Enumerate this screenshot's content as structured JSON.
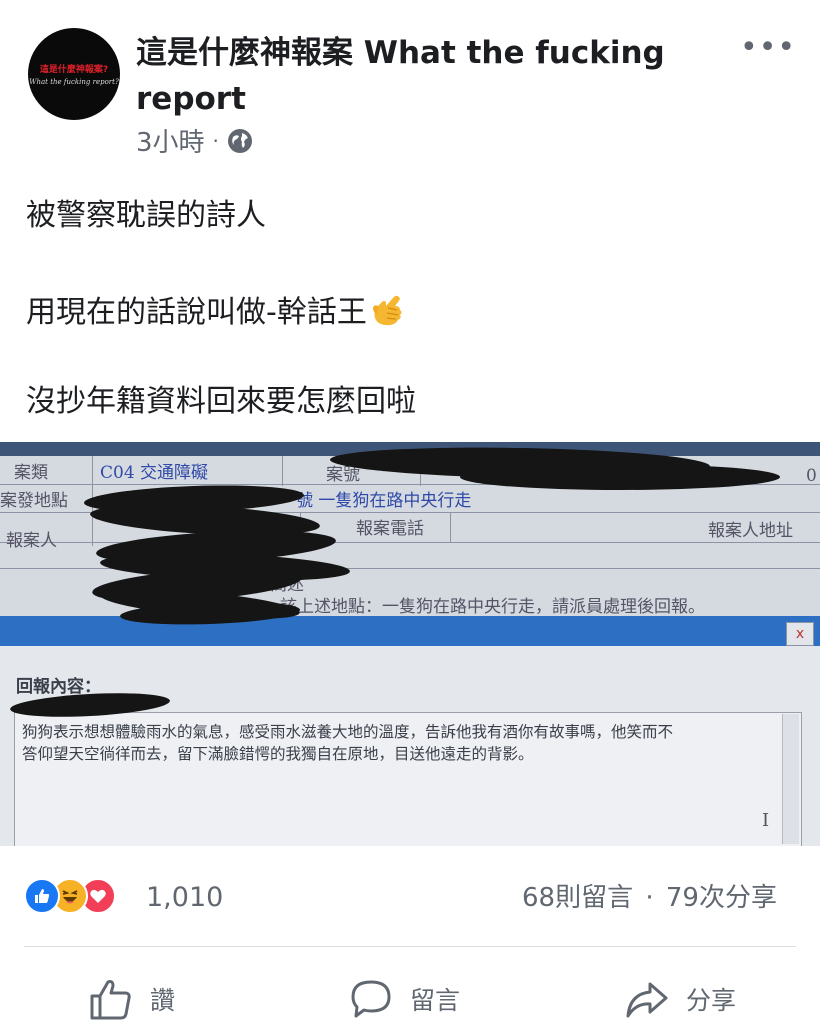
{
  "post": {
    "page_name": "這是什麼神報案 What the fucking report",
    "avatar_line1": "這是什麼神報案?",
    "avatar_line2": "What the fucking report?",
    "timestamp": "3小時",
    "separator": "·",
    "text_line1": "被警察耽誤的詩人",
    "text_line2": "用現在的話說叫做-幹話王",
    "text_line3": "沒抄年籍資料回來要怎麼回啦",
    "emoji": "call-me-hand"
  },
  "photo": {
    "case_type_label": "案類",
    "case_type_value": "C04 交通障礙",
    "case_no_label": "案號",
    "case_no_tail": "0",
    "location_label": "案發地點",
    "location_value": "號 一隻狗在路中央行走",
    "reporter_label": "報案人",
    "phone_label": "報案電話",
    "address_label": "報案人地址",
    "desc_label": "簡述",
    "desc_value": "該上述地點：一隻狗在路中央行走，請派員處理後回報。",
    "report_label": "回報內容：",
    "report_line1": "狗狗表示想想體驗雨水的氣息，感受雨水滋養大地的溫度，告訴他我有酒你有故事嗎，他笑而不",
    "report_line2": "答仰望天空徜徉而去，留下滿臉錯愕的我獨自在原地，目送他遠走的背影。",
    "close_btn": "x"
  },
  "stats": {
    "reaction_count": "1,010",
    "comments": "68則留言",
    "separator": "·",
    "shares": "79次分享",
    "reactions": [
      "like-icon",
      "haha-icon",
      "love-icon"
    ]
  },
  "actions": {
    "like": "讚",
    "comment": "留言",
    "share": "分享"
  },
  "colors": {
    "fb_blue": "#1877f2",
    "love_red": "#f33e58",
    "haha_yellow": "#f7b125",
    "text_gray": "#606770",
    "window_blue": "#2d6fc2"
  }
}
